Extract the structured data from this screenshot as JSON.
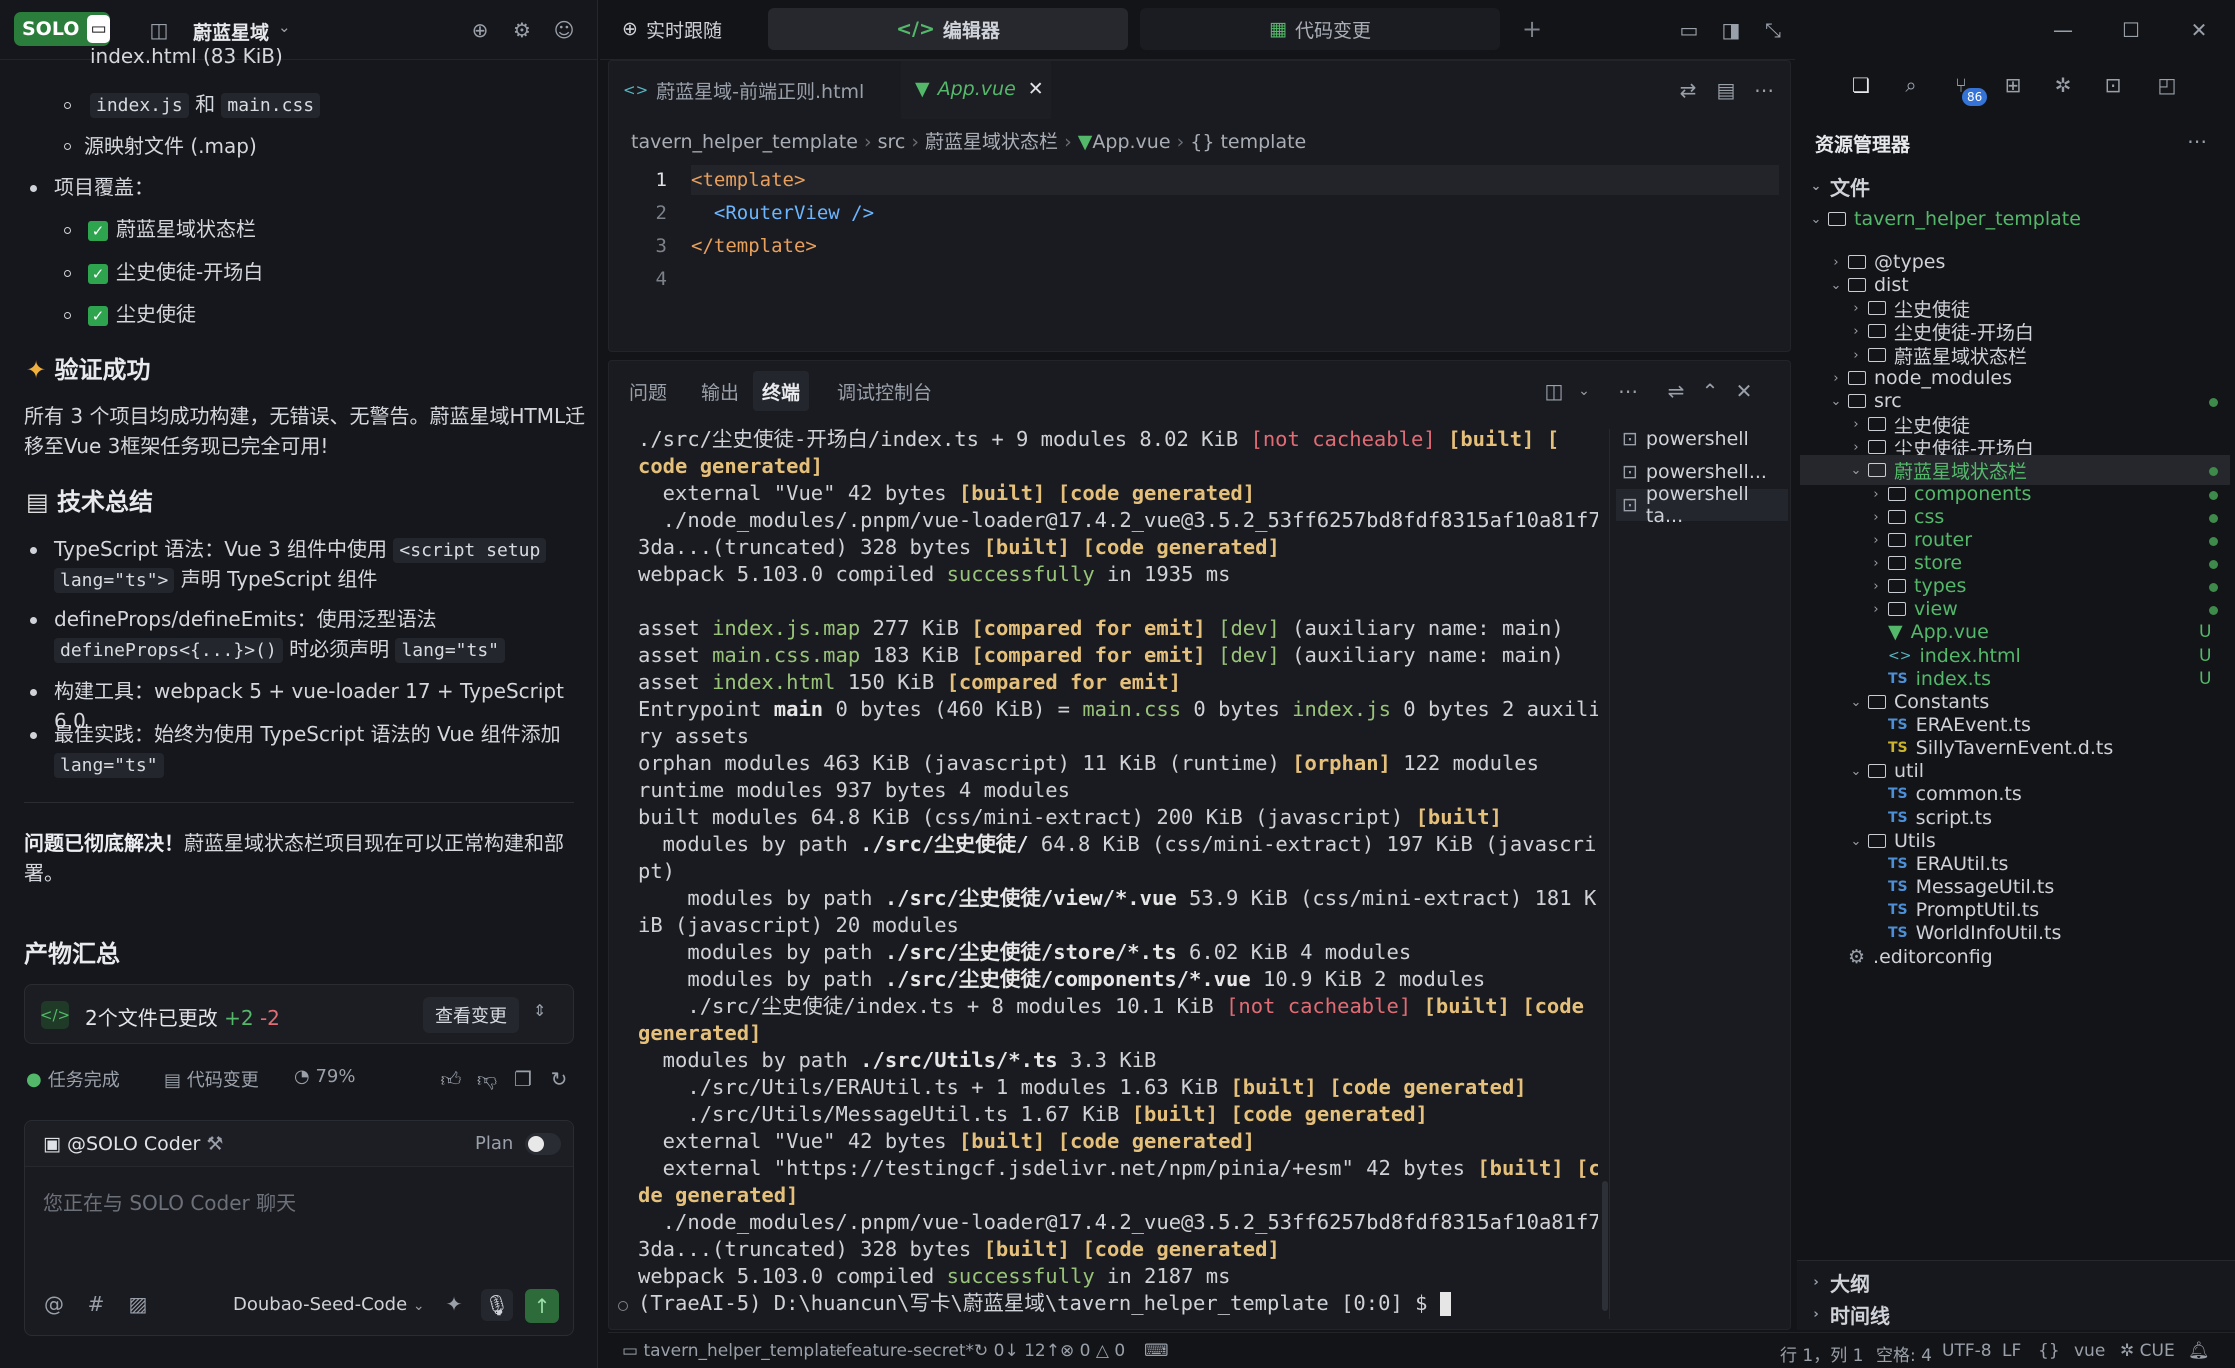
{
  "left_topbar": {
    "badge": "SOLO",
    "project": "蔚蓝星域"
  },
  "chat": {
    "partial_top": "index.html (83 KiB)",
    "line_js": "index.js",
    "line_and": "和",
    "line_css": "main.css",
    "line_map": "源映射文件 (.map)",
    "coverage_title": "项目覆盖：",
    "coverage_items": [
      "蔚蓝星域状态栏",
      "尘史使徒-开场白",
      "尘史使徒"
    ],
    "verify_title": "验证成功",
    "verify_text_1": "所有 3 个项目均成功构建，无错误、无警告。蔚蓝星域HTML迁",
    "verify_text_2": "移至Vue 3框架任务现已完全可用!",
    "tech_title": "技术总结",
    "tech_1a": "TypeScript 语法：Vue 3 组件中使用",
    "tech_1code1": "<script setup",
    "tech_1code2": "lang=\"ts\">",
    "tech_1b": "声明 TypeScript 组件",
    "tech_2a": "defineProps/defineEmits：使用泛型语法",
    "tech_2code1": "defineProps<{...}>()",
    "tech_2b": "时必须声明",
    "tech_2code2": "lang=\"ts\"",
    "tech_3": "构建工具：webpack 5 + vue-loader 17 + TypeScript 6.0",
    "tech_4a": "最佳实践：始终为使用 TypeScript 语法的 Vue 组件添加",
    "tech_4code": "lang=\"ts\"",
    "solved_bold": "问题已彻底解决！",
    "solved_text_1": "蔚蓝星域状态栏项目现在可以正常构建和部",
    "solved_text_2": "署。",
    "artifacts_title": "产物汇总",
    "changes_label": "2个文件已更改",
    "changes_add": "+2",
    "changes_del": "-2",
    "view_changes": "查看变更",
    "task_done": "任务完成",
    "code_changes": "代码变更",
    "progress": "79%",
    "coder_name": "@SOLO Coder",
    "plan_label": "Plan",
    "input_placeholder": "您正在与 SOLO Coder 聊天",
    "model_name": "Doubao-Seed-Code"
  },
  "center_tabs": [
    "实时跟随",
    "编辑器",
    "代码变更"
  ],
  "editor": {
    "file_tabs": [
      "蔚蓝星域-前端正则.html",
      "App.vue"
    ],
    "breadcrumb": [
      "tavern_helper_template",
      "src",
      "蔚蓝星域状态栏",
      "App.vue",
      "template"
    ],
    "line_numbers": [
      "1",
      "2",
      "3",
      "4"
    ],
    "lines": [
      "<template>",
      "  <RouterView />",
      "</template>",
      ""
    ]
  },
  "panel_tabs": [
    "问题",
    "输出",
    "终端",
    "调试控制台"
  ],
  "terminal_sessions": [
    "powershell",
    "powershell...",
    "powershell ta..."
  ],
  "terminal": {
    "l1": "./src/尘史使徒-开场白/index.ts + 9 modules 8.02 KiB ",
    "l1r": "[not cacheable]",
    "l1y": " [built] [",
    "l2": "code generated]",
    "l3a": "  external \"Vue\" 42 bytes ",
    "l3b": "[built] [code generated]",
    "l4": "  ./node_modules/.pnpm/vue-loader@17.4.2_vue@3.5.2_53ff6257bd8fdf8315af10a81f7e",
    "l5a": "3da...(truncated) 328 bytes ",
    "l5b": "[built] [code generated]",
    "l6a": "webpack 5.103.0 compiled ",
    "l6b": "successfully",
    "l6c": " in 1935 ms",
    "a1a": "asset ",
    "a1b": "index.js.map",
    "a1c": " 277 KiB ",
    "a1d": "[compared for emit]",
    "a1e": " [dev]",
    "a1f": " (auxiliary name: main)",
    "a2b": "main.css.map",
    "a2c": " 183 KiB ",
    "a3b": "index.html",
    "a3c": " 150 KiB ",
    "e1": "Entrypoint ",
    "e2": "main",
    "e3": " 0 bytes (460 KiB) = ",
    "e4": "main.css",
    "e5": " 0 bytes ",
    "e6": "index.js",
    "e7": " 0 bytes 2 auxilia",
    "e8": "ry assets",
    "o1": "orphan modules 463 KiB (javascript) 11 KiB (runtime) ",
    "o2": "[orphan]",
    "o3": " 122 modules",
    "rt": "runtime modules 937 bytes 4 modules",
    "bm1": "built modules 64.8 KiB (css/mini-extract) 200 KiB (javascript) ",
    "bm2": "[built]",
    "mp1": "  modules by path ",
    "mp2": "./src/尘史使徒/",
    "mp3": " 64.8 KiB (css/mini-extract) 197 KiB (javascri",
    "mp4": "pt)",
    "v1": "    modules by path ",
    "v2": "./src/尘史使徒/view/*.vue",
    "v3": " 53.9 KiB (css/mini-extract) 181 K",
    "v4": "iB (javascript) 20 modules",
    "s2": "./src/尘史使徒/store/*.ts",
    "s3": " 6.02 KiB 4 modules",
    "c2": "./src/尘史使徒/components/*.vue",
    "c3": " 10.9 KiB 2 modules",
    "i1": "    ./src/尘史使徒/index.ts + 8 modules 10.1 KiB ",
    "i2": "[not cacheable]",
    "i3": " [built] [code",
    "i4": "generated]",
    "u2": "./src/Utils/*.ts",
    "u3": " 3.3 KiB",
    "u4": "    ./src/Utils/ERAUtil.ts + 1 modules 1.63 KiB ",
    "u5": "[built] [code generated]",
    "u6": "    ./src/Utils/MessageUtil.ts 1.67 KiB ",
    "x1": "  external \"https://testingcf.jsdelivr.net/npm/pinia/+esm\" 42 bytes ",
    "x2": "[built] [co",
    "x3": "de generated]",
    "w3": " in 2187 ms",
    "prompt": "(TraeAI-5) D:\\huancun\\写卡\\蔚蓝星域\\tavern_helper_template [0:0] $ "
  },
  "explorer": {
    "title": "资源管理器",
    "section_files": "文件",
    "root": "tavern_helper_template",
    "items": [
      "@types",
      "dist",
      "尘史使徒",
      "尘史使徒-开场白",
      "蔚蓝星域状态栏",
      "node_modules",
      "src",
      "尘史使徒",
      "尘史使徒-开场白",
      "蔚蓝星域状态栏",
      "components",
      "css",
      "router",
      "store",
      "types",
      "view",
      "App.vue",
      "index.html",
      "index.ts",
      "Constants",
      "ERAEvent.ts",
      "SillyTavernEvent.d.ts",
      "util",
      "common.ts",
      "script.ts",
      "Utils",
      "ERAUtil.ts",
      "MessageUtil.ts",
      "PromptUtil.ts",
      "WorldInfoUtil.ts",
      ".editorconfig"
    ],
    "badge_count": "86",
    "outline": "大纲",
    "timeline": "时间线"
  },
  "statusbar": {
    "repo": "tavern_helper_template",
    "branch": "feature-secret*",
    "sync": "0↓ 12↑",
    "errors": "0",
    "warnings": "0",
    "position": "行 1，列 1",
    "spaces": "空格: 4",
    "encoding": "UTF-8",
    "eol": "LF",
    "lang": "vue",
    "cue": "CUE"
  }
}
